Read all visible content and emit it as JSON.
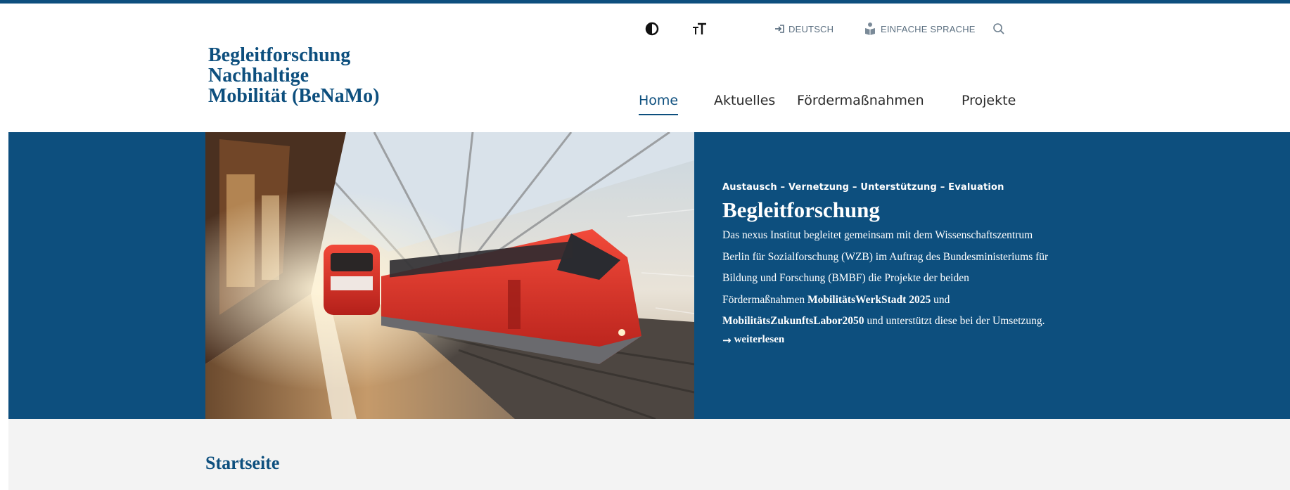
{
  "site": {
    "logo_lines": [
      "Begleitforschung",
      "Nachhaltige",
      "Mobilität (BeNaMo)"
    ]
  },
  "utility": {
    "contrast_icon": "contrast-icon",
    "text_size_icon": "text-size-icon",
    "language_label": "DEUTSCH",
    "simple_language_label": "EINFACHE SPRACHE",
    "search_icon": "search-icon"
  },
  "nav": {
    "items": [
      {
        "label": "Home",
        "active": true
      },
      {
        "label": "Aktuelles",
        "active": false
      },
      {
        "label": "Fördermaßnahmen",
        "active": false
      },
      {
        "label": "Projekte",
        "active": false
      }
    ]
  },
  "hero": {
    "kicker": "Austausch – Vernetzung – Unterstützung – Evaluation",
    "title": "Begleitforschung",
    "body_1": "Das nexus Institut begleitet gemeinsam mit dem Wissenschaftszentrum Berlin für Sozialforschung (WZB) im Auftrag des Bundesministeriums für Bildung und Forschung (BMBF) die Projekte der beiden Fördermaßnahmen ",
    "program_1": "MobilitätsWerkStadt 2025",
    "connector": " und ",
    "program_2": "MobilitätsZukunftsLabor2050",
    "body_2": " und unterstützt diese bei der Umsetzung.",
    "read_more": "weiterlesen"
  },
  "page": {
    "title": "Startseite"
  },
  "colors": {
    "brand": "#0d4f7e",
    "lower_bg": "#f3f3f3"
  }
}
